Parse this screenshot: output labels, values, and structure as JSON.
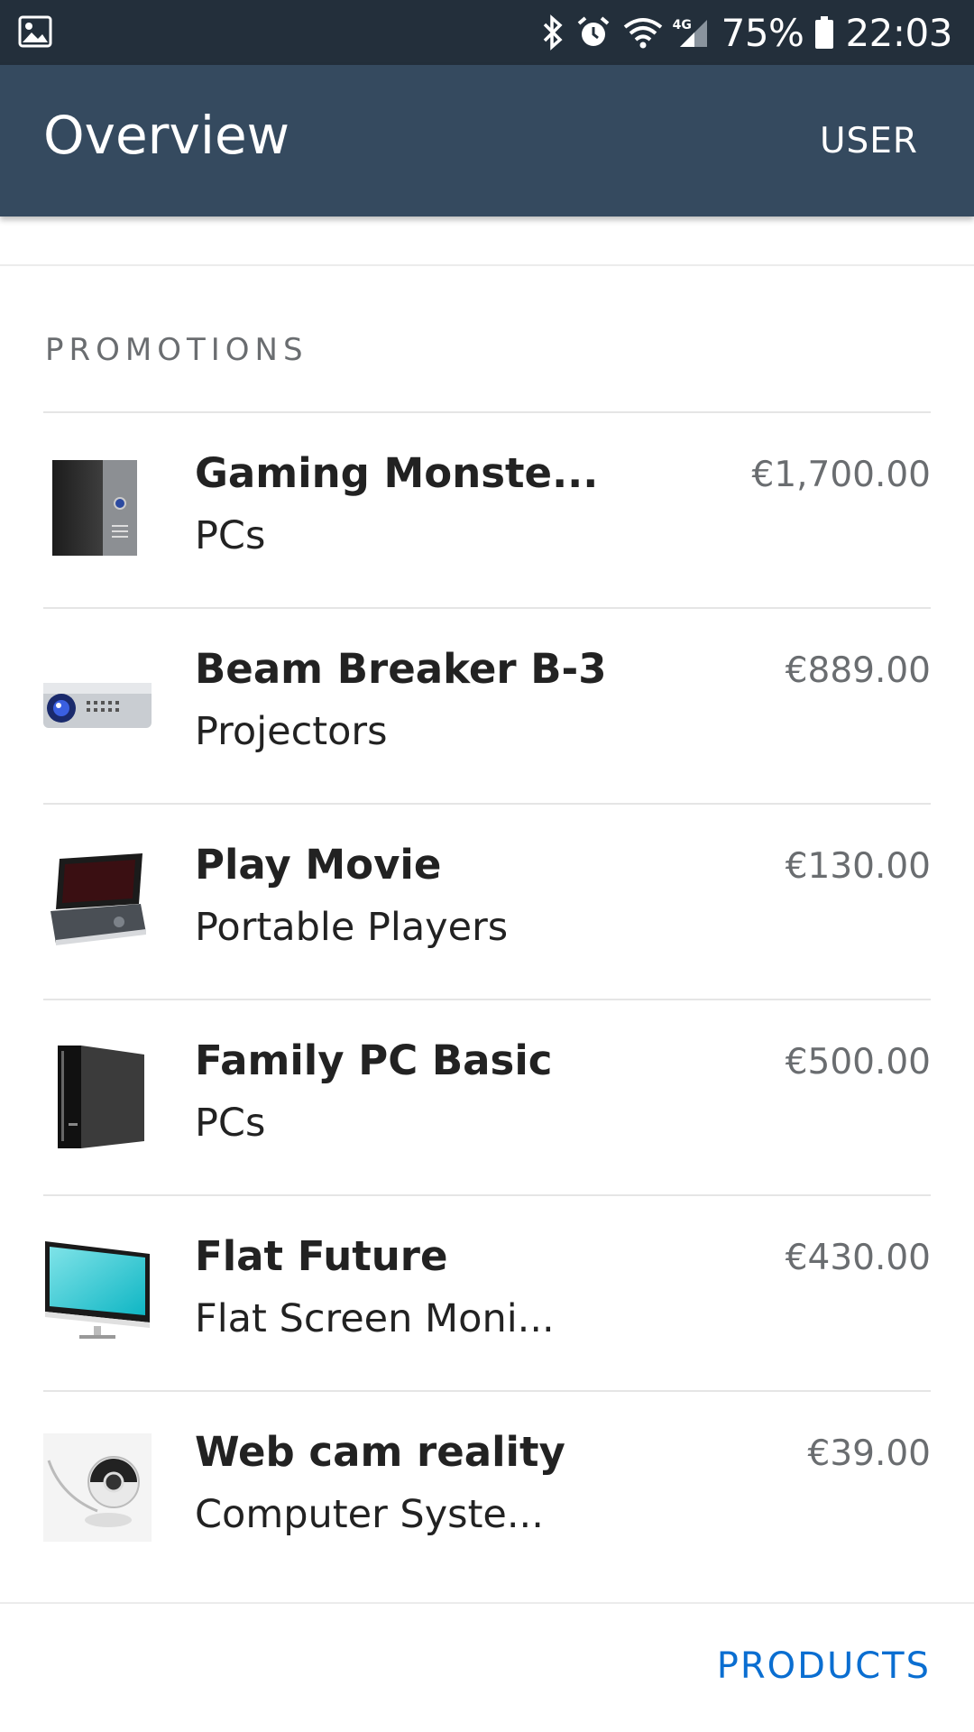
{
  "status_bar": {
    "battery_percent": "75%",
    "time": "22:03",
    "network_label": "4G",
    "icons": [
      "image-icon",
      "bluetooth-icon",
      "alarm-icon",
      "wifi-icon",
      "signal-icon",
      "battery-icon"
    ]
  },
  "app_bar": {
    "title": "Overview",
    "user_label": "USER"
  },
  "section": {
    "title": "PROMOTIONS"
  },
  "products": [
    {
      "name": "Gaming Monste...",
      "category": "PCs",
      "price": "€1,700.00",
      "icon": "desktop-tower-icon"
    },
    {
      "name": "Beam Breaker B-3",
      "category": "Projectors",
      "price": "€889.00",
      "icon": "projector-icon"
    },
    {
      "name": "Play Movie",
      "category": "Portable Players",
      "price": "€130.00",
      "icon": "portable-dvd-player-icon"
    },
    {
      "name": "Family PC Basic",
      "category": "PCs",
      "price": "€500.00",
      "icon": "black-pc-tower-icon"
    },
    {
      "name": "Flat Future",
      "category": "Flat Screen Moni...",
      "price": "€430.00",
      "icon": "monitor-icon"
    },
    {
      "name": "Web cam reality",
      "category": "Computer Syste...",
      "price": "€39.00",
      "icon": "webcam-icon"
    }
  ],
  "footer": {
    "products_label": "PRODUCTS"
  },
  "colors": {
    "status_bar_bg": "#232f3b",
    "app_bar_bg": "#354a5f",
    "accent_link": "#0a6ed1",
    "secondary_text": "#6a6d70"
  }
}
